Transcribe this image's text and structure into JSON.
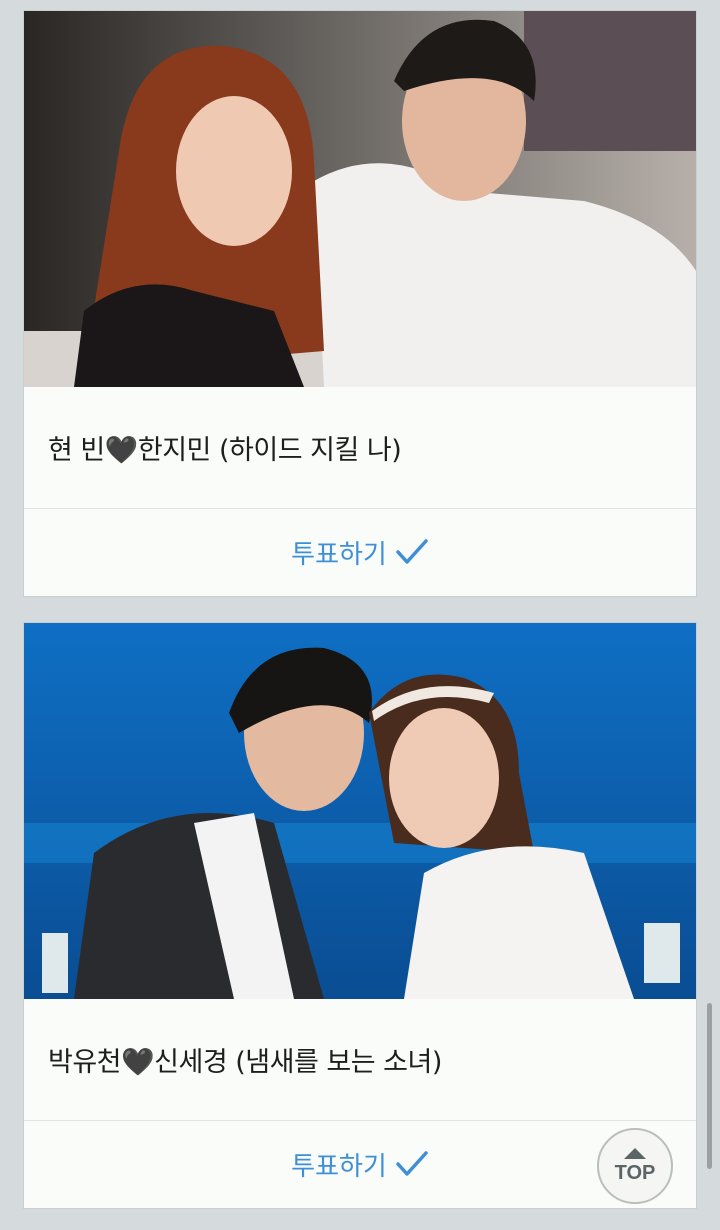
{
  "cards": [
    {
      "caption": "현 빈🖤한지민 (하이드 지킬 나)",
      "vote_label": "투표하기"
    },
    {
      "caption": "박유천🖤신세경 (냄새를 보는 소녀)",
      "vote_label": "투표하기"
    }
  ],
  "top_button": {
    "label": "TOP"
  },
  "colors": {
    "background": "#d5dbdc",
    "card": "#fafcf9",
    "accent_blue": "#3e8fd6"
  }
}
